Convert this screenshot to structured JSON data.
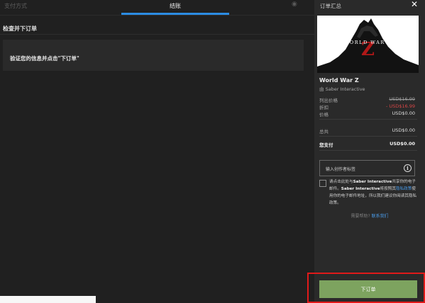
{
  "tabs": {
    "payment_label": "支付方式",
    "checkout_label": "结账"
  },
  "checkout": {
    "section_title": "检查并下订单",
    "verify_text": "验证您的信息并点击\"下订单\""
  },
  "summary": {
    "title": "订单汇总",
    "game": {
      "cover_text": "WORLD WAR Z",
      "title": "World War Z",
      "publisher": "由 Saber Interactive"
    },
    "prices": {
      "list_label": "列出价格",
      "list_value": "USD$16.99",
      "discount_label": "折扣",
      "discount_value": "- USD$16.99",
      "price_label": "价格",
      "price_value": "USD$0.00",
      "total_label": "总共",
      "total_value": "USD$0.00",
      "due_label": "您支付",
      "due_value": "USD$0.00"
    },
    "creator_tag_placeholder": "输入创作者标签",
    "consent": {
      "part1": "请点击此处与",
      "company1": "Saber Interactive",
      "part2": "共享你的电子邮件。",
      "company2": "Saber Interactive",
      "part3": "将按照其",
      "link": "隐私政策",
      "part4": "使用你的电子邮件地址，所以我们建议你阅读其隐私政策。"
    },
    "help_prefix": "需要帮助?",
    "help_link": "联系我们",
    "order_button": "下订单"
  },
  "colors": {
    "accent": "#2b8ce3",
    "order_button": "#7da35f",
    "highlight": "#e01a1a",
    "discount": "#d64646"
  }
}
